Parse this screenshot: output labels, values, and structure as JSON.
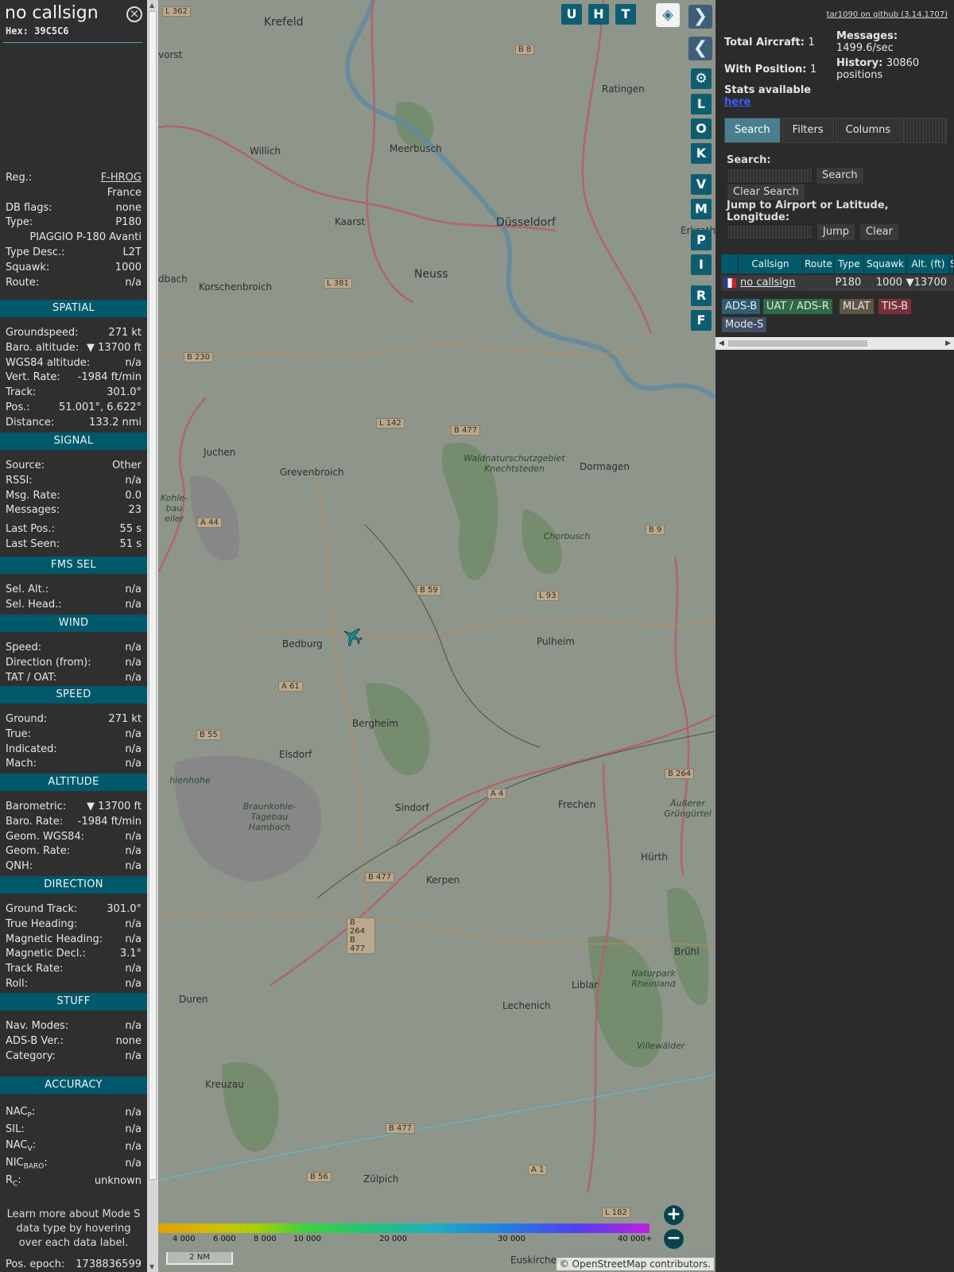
{
  "detail": {
    "title": "no callsign",
    "hex_label": "Hex:",
    "hex": "39C5C6",
    "general": [
      {
        "label": "Reg.:",
        "value": "F-HROG"
      },
      {
        "label": "",
        "value": "France"
      },
      {
        "label": "DB flags:",
        "value": "none"
      },
      {
        "label": "Type:",
        "value": "P180"
      },
      {
        "label": "",
        "value": "PIAGGIO P-180 Avanti"
      },
      {
        "label": "Type Desc.:",
        "value": "L2T"
      },
      {
        "label": "Squawk:",
        "value": "1000"
      },
      {
        "label": "Route:",
        "value": "n/a"
      }
    ],
    "sections": [
      {
        "title": "SPATIAL",
        "rows": [
          {
            "label": "Groundspeed:",
            "value": "271 kt"
          },
          {
            "label": "Baro. altitude:",
            "value": "▼ 13700 ft"
          },
          {
            "label": "WGS84 altitude:",
            "value": "n/a"
          },
          {
            "label": "Vert. Rate:",
            "value": "-1984 ft/min"
          },
          {
            "label": "Track:",
            "value": "301.0°"
          },
          {
            "label": "Pos.:",
            "value": "51.001°, 6.622°"
          },
          {
            "label": "Distance:",
            "value": "133.2 nmi"
          }
        ]
      },
      {
        "title": "SIGNAL",
        "rows": [
          {
            "label": "Source:",
            "value": "Other"
          },
          {
            "label": "RSSI:",
            "value": "n/a"
          },
          {
            "label": "Msg. Rate:",
            "value": "0.0"
          },
          {
            "label": "Messages:",
            "value": "23"
          },
          {
            "label": "Last Pos.:",
            "value": "55 s"
          },
          {
            "label": "Last Seen:",
            "value": "51 s"
          }
        ]
      },
      {
        "title": "FMS SEL",
        "rows": [
          {
            "label": "Sel. Alt.:",
            "value": "n/a"
          },
          {
            "label": "Sel. Head.:",
            "value": "n/a"
          }
        ]
      },
      {
        "title": "WIND",
        "rows": [
          {
            "label": "Speed:",
            "value": "n/a"
          },
          {
            "label": "Direction (from):",
            "value": "n/a"
          },
          {
            "label": "TAT / OAT:",
            "value": "n/a"
          }
        ]
      },
      {
        "title": "SPEED",
        "rows": [
          {
            "label": "Ground:",
            "value": "271 kt"
          },
          {
            "label": "True:",
            "value": "n/a"
          },
          {
            "label": "Indicated:",
            "value": "n/a"
          },
          {
            "label": "Mach:",
            "value": "n/a"
          }
        ]
      },
      {
        "title": "ALTITUDE",
        "rows": [
          {
            "label": "Barometric:",
            "value": "▼ 13700 ft"
          },
          {
            "label": "Baro. Rate:",
            "value": "-1984 ft/min"
          },
          {
            "label": "Geom. WGS84:",
            "value": "n/a"
          },
          {
            "label": "Geom. Rate:",
            "value": "n/a"
          },
          {
            "label": "QNH:",
            "value": "n/a"
          }
        ]
      },
      {
        "title": "DIRECTION",
        "rows": [
          {
            "label": "Ground Track:",
            "value": "301.0°"
          },
          {
            "label": "True Heading:",
            "value": "n/a"
          },
          {
            "label": "Magnetic Heading:",
            "value": "n/a"
          },
          {
            "label": "Magnetic Decl.:",
            "value": "3.1°"
          },
          {
            "label": "Track Rate:",
            "value": "n/a"
          },
          {
            "label": "Roll:",
            "value": "n/a"
          }
        ]
      },
      {
        "title": "STUFF",
        "rows": [
          {
            "label": "Nav. Modes:",
            "value": "n/a"
          },
          {
            "label": "ADS-B Ver.:",
            "value": "none"
          },
          {
            "label": "Category:",
            "value": "n/a"
          }
        ]
      },
      {
        "title": "ACCURACY",
        "rows": [
          {
            "label": "NACP:",
            "value": "n/a"
          },
          {
            "label": "SIL:",
            "value": "n/a"
          },
          {
            "label": "NACV:",
            "value": "n/a"
          },
          {
            "label": "NICBARO:",
            "value": "n/a"
          },
          {
            "label": "RC:",
            "value": "unknown"
          }
        ]
      }
    ],
    "accuracy_labels": {
      "nac_main": "NAC",
      "nac_p_sub": "P",
      "nac_v_sub": "V",
      "nic_main": "NIC",
      "nic_sub": "BARO",
      "rc_main": "R",
      "rc_sub": "C"
    },
    "note": "Learn more about Mode S data type by hovering over each data label.",
    "epoch_label": "Pos. epoch:",
    "epoch_value": "1738836599"
  },
  "map": {
    "buttons": [
      "U",
      "H",
      "T"
    ],
    "side_buttons": [
      "L",
      "O",
      "K",
      "V",
      "M",
      "P",
      "I",
      "R",
      "F"
    ],
    "cities": [
      "Krefeld",
      "Meerbusch",
      "Ratingen",
      "Willich",
      "Kaarst",
      "Düsseldorf",
      "Erkrath",
      "Neuss",
      "Korschenbroich",
      "dbach",
      "Juchen",
      "Grevenbroich",
      "Dormagen",
      "Bedburg",
      "Pulheim",
      "Bergheim",
      "Elsdorf",
      "Frechen",
      "Sindorf",
      "Kerpen",
      "Hürth",
      "Brühl",
      "Liblar",
      "Lechenich",
      "Duren",
      "Kreuzau",
      "Zülpich",
      "Euskirchen",
      "vorst"
    ],
    "nature_labels": [
      "Waldnaturschutzgebiet Knechtsteden",
      "Chorbusch",
      "Braunkohle-Tagebau Hambach",
      "Naturpark Rheinland",
      "Villewälder",
      "Äußerer Grüngürtel",
      "hienhohe",
      "Kohle-bau eiler"
    ],
    "road_badges": [
      "L 362",
      "B 8",
      "L 381",
      "B 230",
      "L 142",
      "B 477",
      "A 44",
      "B 59",
      "L 93",
      "B 9",
      "A 61",
      "B 55",
      "A 4",
      "B 264",
      "B 477",
      "B 264 B 477",
      "B 477",
      "B 56",
      "A 1",
      "L 182"
    ],
    "colorbar_ticks": [
      "4 000",
      "6 000",
      "8 000",
      "10 000",
      "20 000",
      "30 000",
      "40 000+"
    ],
    "scale": "2 NM",
    "attribution": "© OpenStreetMap contributors.",
    "zoom_in": "+",
    "zoom_out": "−"
  },
  "sidebar": {
    "github": "tar1090 on github (3.14.1707)",
    "total_label": "Total Aircraft:",
    "total": "1",
    "withpos_label": "With Position:",
    "withpos": "1",
    "stats_label": "Stats available",
    "stats_link": "here",
    "messages_label": "Messages:",
    "messages": "1499.6/sec",
    "history_label": "History:",
    "history": "30860",
    "history_unit": "positions",
    "tabs": [
      "Search",
      "Filters",
      "Columns"
    ],
    "search_label": "Search:",
    "search_btn": "Search",
    "clear_search_btn": "Clear Search",
    "jump_label": "Jump to Airport or Latitude, Longitude:",
    "jump_btn": "Jump",
    "clear_btn": "Clear",
    "columns": [
      "Callsign",
      "Route",
      "Type",
      "Squawk",
      "Alt. (ft)",
      "S"
    ],
    "row": {
      "callsign": "no callsign",
      "route": "",
      "type": "P180",
      "squawk": "1000",
      "alt": "▼13700"
    },
    "legend": [
      {
        "label": "ADS-B",
        "color": "#2f5b73"
      },
      {
        "label": "UAT / ADS-R",
        "color": "#2d6a45"
      },
      {
        "label": "MLAT",
        "color": "#5d5545"
      },
      {
        "label": "TIS-B",
        "color": "#7a2f3b"
      },
      {
        "label": "Mode-S",
        "color": "#3e4f66"
      }
    ]
  }
}
